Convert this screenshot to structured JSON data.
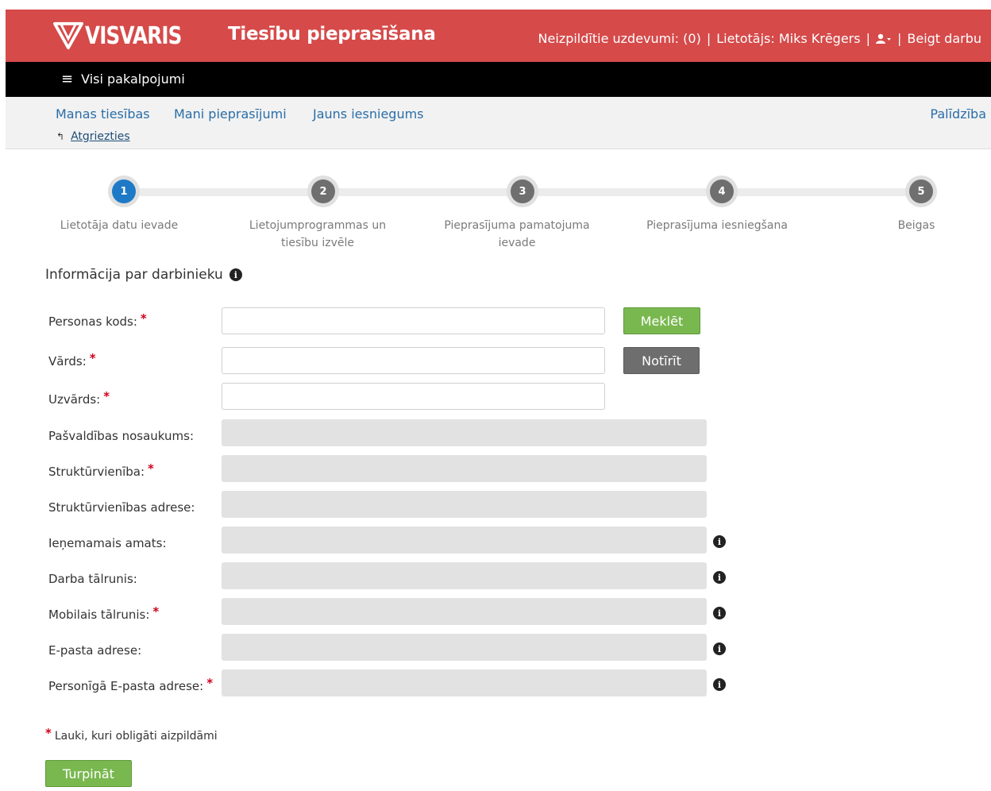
{
  "header": {
    "logo_text": "VISVARIS",
    "app_title": "Tiesību pieprasīšana",
    "pending_tasks": "Neizpildītie uzdevumi: (0)",
    "user": "Lietotājs: Miks Krēgers",
    "separator": "|",
    "logout": "Beigt darbu",
    "brand_color": "#d64a4a"
  },
  "nav": {
    "all_services": "Visi pakalpojumi"
  },
  "subnav": {
    "my_rights": "Manas tiesības",
    "my_requests": "Mani pieprasījumi",
    "new_application": "Jauns iesniegums",
    "help": "Palīdzība",
    "back": "Atgriezties"
  },
  "steps": [
    {
      "number": "1",
      "label": "Lietotāja datu ievade",
      "active": true
    },
    {
      "number": "2",
      "label": "Lietojumprogrammas un tiesību izvēle",
      "active": false
    },
    {
      "number": "3",
      "label": "Pieprasījuma pamatojuma ievade",
      "active": false
    },
    {
      "number": "4",
      "label": "Pieprasījuma iesniegšana",
      "active": false
    },
    {
      "number": "5",
      "label": "Beigas",
      "active": false
    }
  ],
  "form": {
    "section_title": "Informācija par darbinieku",
    "required_mark": "*",
    "fields": {
      "personal_code": {
        "label": "Personas kods:",
        "value": ""
      },
      "first_name": {
        "label": "Vārds:",
        "value": ""
      },
      "last_name": {
        "label": "Uzvārds:",
        "value": ""
      },
      "municipality": {
        "label": "Pašvaldības nosaukums:",
        "value": ""
      },
      "department": {
        "label": "Struktūrvienība:",
        "value": ""
      },
      "department_address": {
        "label": "Struktūrvienības adrese:",
        "value": ""
      },
      "position": {
        "label": "Ieņemamais amats:",
        "value": ""
      },
      "work_phone": {
        "label": "Darba tālrunis:",
        "value": ""
      },
      "mobile_phone": {
        "label": "Mobilais tālrunis:",
        "value": ""
      },
      "email": {
        "label": "E-pasta adrese:",
        "value": ""
      },
      "personal_email": {
        "label": "Personīgā E-pasta adrese:",
        "value": ""
      }
    },
    "search_button": "Meklēt",
    "clear_button": "Notīrīt",
    "footnote": "Lauki, kuri obligāti aizpildāmi",
    "continue_button": "Turpināt"
  }
}
